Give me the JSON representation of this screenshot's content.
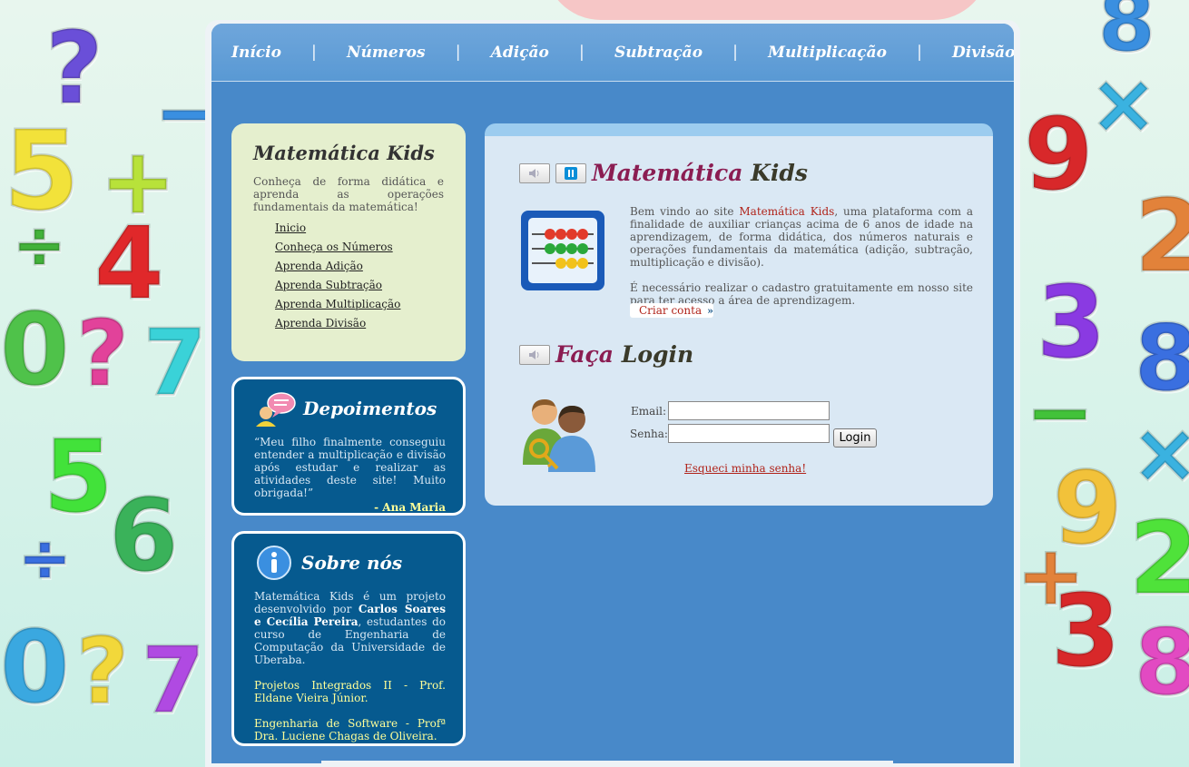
{
  "nav": {
    "items": [
      {
        "label": "Início"
      },
      {
        "label": "Números"
      },
      {
        "label": "Adição"
      },
      {
        "label": "Subtração"
      },
      {
        "label": "Multiplicação"
      },
      {
        "label": "Divisão"
      }
    ],
    "separator": "|"
  },
  "sidebar": {
    "title": "Matemática Kids",
    "description": "Conheça de forma didática e aprenda as operações fundamentais da matemática!",
    "links": [
      "Inicio",
      "Conheça os Números",
      "Aprenda Adição",
      "Aprenda Subtração",
      "Aprenda Multiplicação",
      "Aprenda Divisão"
    ]
  },
  "testimonials": {
    "title": "Depoimentos",
    "quote": "“Meu filho finalmente conseguiu entender a multiplicação e divisão após estudar e realizar as atividades deste site! Muito obrigada!”",
    "author": "- Ana Maria"
  },
  "about": {
    "title": "Sobre nós",
    "text_before": "Matemática Kids é um projeto desenvolvido por ",
    "authors": "Carlos Soares e Cecília Pereira",
    "text_after": ", estudantes do curso de Engenharia de Computação da Universidade de Uberaba.",
    "line2": "Projetos Integrados II - Prof. Eldane Vieira Júnior.",
    "line3": "Engenharia de Software - Profª Dra. Luciene Chagas de Oliveira."
  },
  "main": {
    "title_part1": "Matemática",
    "title_part2": "Kids",
    "welcome_before": "Bem vindo ao site ",
    "welcome_brand": "Matemática Kids",
    "welcome_after": ", uma plataforma com a finalidade de auxiliar crianças acima de 6 anos de idade na aprendizagem, de forma didática, dos números naturais e operações fundamentais da matemática (adição, subtração, multiplicação e divisão).",
    "register_note": "É necessário realizar o cadastro gratuitamente em nosso site para ter acesso a área de aprendizagem.",
    "create_account": "Criar conta",
    "create_account_icon": "»"
  },
  "login": {
    "title_part1": "Faça",
    "title_part2": "Login",
    "email_label": "Email:",
    "password_label": "Senha:",
    "email_value": "",
    "password_value": "",
    "button": "Login",
    "forgot": "Esqueci minha senha!"
  },
  "colors": {
    "page_blue": "#4889c9",
    "nav_blue": "#5999d4",
    "dark_box": "#065a8f",
    "intro_green": "#e5efce",
    "main_panel": "#dae8f4",
    "title_magenta": "#8b1d52",
    "link_red": "#b0231a",
    "highlight_yellow": "#ffff99"
  }
}
